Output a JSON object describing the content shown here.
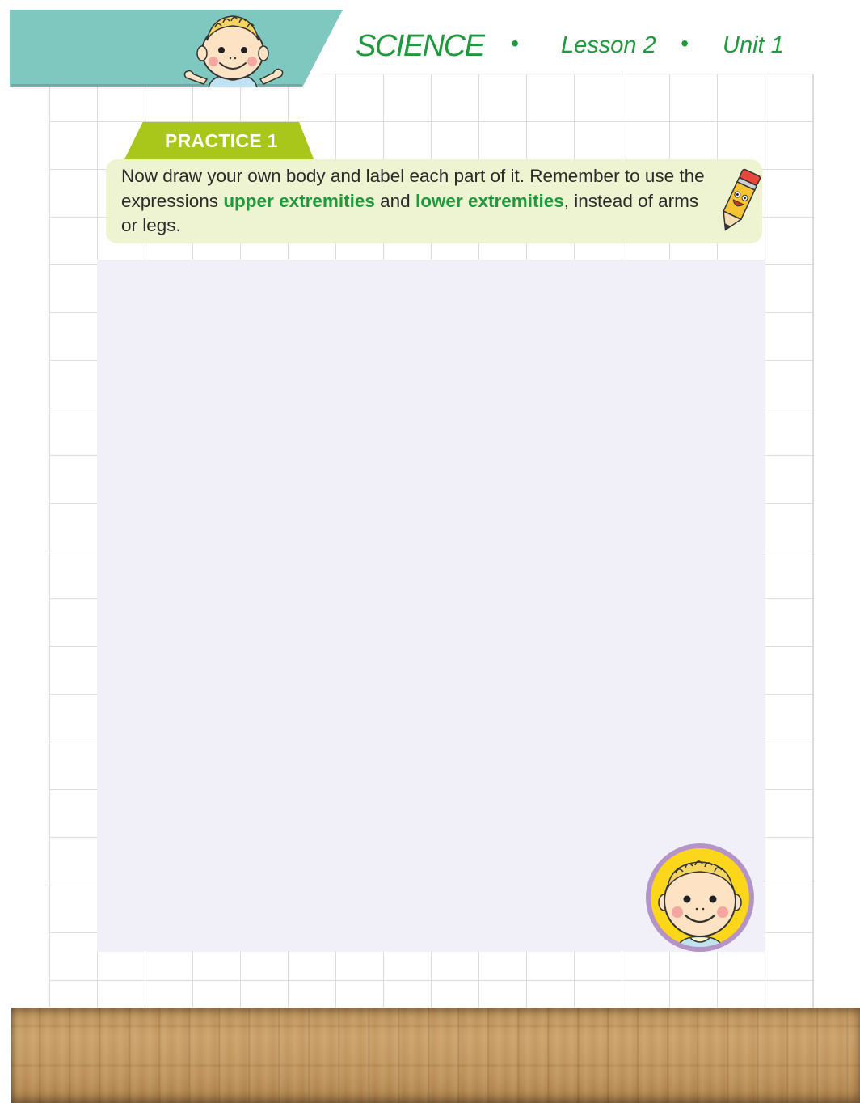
{
  "header": {
    "subject": "SCIENCE",
    "separator": "•",
    "lesson": "Lesson 2",
    "unit": "Unit 1",
    "accent_color": "#1e9a3c",
    "tab_color": "#7ec8c0"
  },
  "practice": {
    "label": "PRACTICE 1",
    "tab_color": "#a9c71a",
    "instruction_part1": "Now draw your own body and label each part of it. Remember to use the expressions ",
    "highlight1": "upper extremities",
    "instruction_part2": " and ",
    "highlight2": "lower extremities",
    "instruction_part3": ", instead of arms or legs."
  },
  "drawing_area": {
    "background_color": "#f1eff7"
  },
  "icons": {
    "header_character": "kid-character-icon",
    "pencil": "smiling-pencil-icon",
    "badge": "kid-face-badge-icon"
  }
}
